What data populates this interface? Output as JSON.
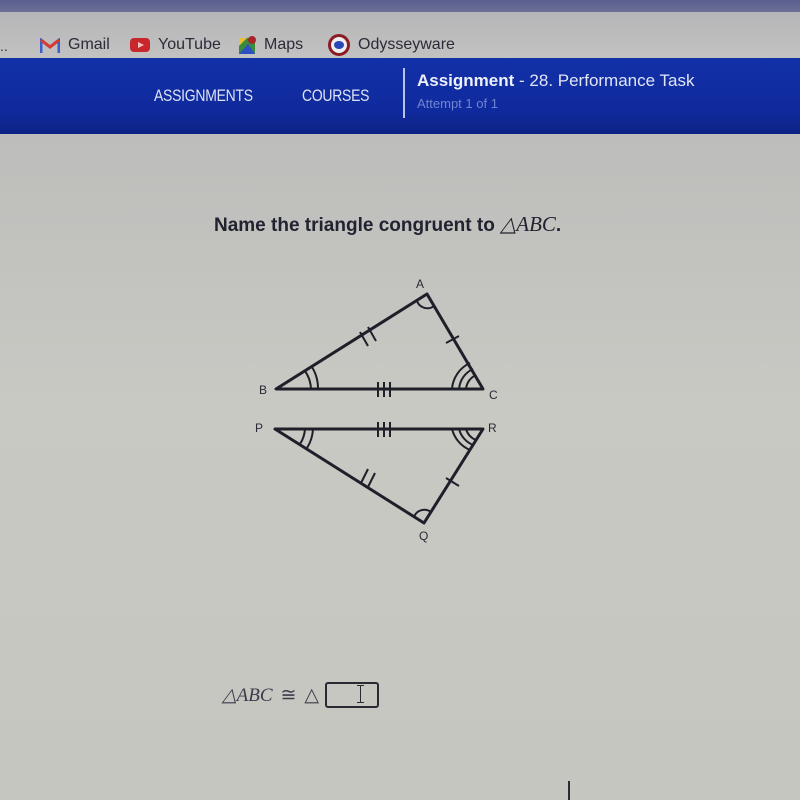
{
  "browser": {
    "overflow_label": "..",
    "bookmarks": [
      {
        "label": "Gmail",
        "icon": "gmail-icon"
      },
      {
        "label": "YouTube",
        "icon": "youtube-icon"
      },
      {
        "label": "Maps",
        "icon": "maps-icon"
      },
      {
        "label": "Odysseyware",
        "icon": "odysseyware-icon"
      }
    ]
  },
  "navbar": {
    "items": [
      {
        "label": "ASSIGNMENTS"
      },
      {
        "label": "COURSES"
      }
    ],
    "assignment_label": "Assignment",
    "assignment_name": " - 28. Performance Task",
    "attempt": "Attempt 1 of 1",
    "colors": {
      "bar": "#1230a8",
      "text": "#dfe3f6",
      "muted": "#6f84d2"
    }
  },
  "question": {
    "prompt": "Name the triangle congruent to ",
    "prompt_math": "△ABC",
    "prompt_end": "."
  },
  "figure": {
    "triangle_top": {
      "vertices": {
        "A": "A",
        "B": "B",
        "C": "C"
      },
      "side_marks": {
        "AB": 2,
        "AC": 1,
        "BC": 3
      },
      "angle_marks": {
        "A": 1,
        "B": 2,
        "C": 3
      }
    },
    "triangle_bottom": {
      "vertices": {
        "P": "P",
        "Q": "Q",
        "R": "R"
      },
      "side_marks": {
        "PQ": 2,
        "QR": 1,
        "PR": 3
      },
      "angle_marks": {
        "Q": 1,
        "P": 2,
        "R": 3
      }
    }
  },
  "answer": {
    "lhs": "△ABC",
    "congruent_symbol": "≅",
    "triangle_symbol": "△",
    "input_value": ""
  }
}
